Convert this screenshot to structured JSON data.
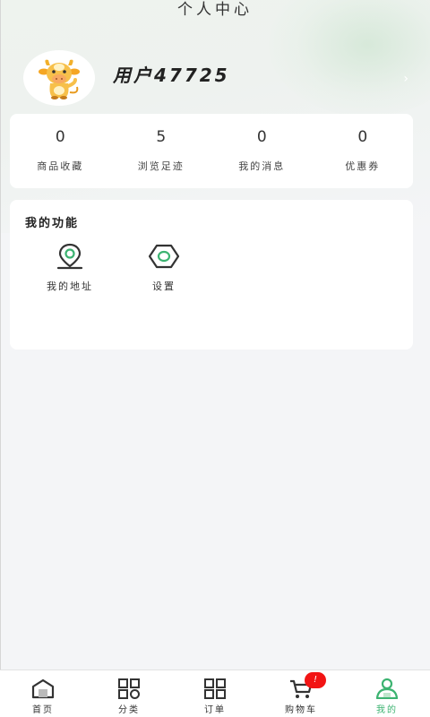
{
  "page": {
    "title": "个人中心"
  },
  "profile": {
    "username": "用户47725",
    "avatar_icon": "cow-mascot-avatar",
    "arrow": "›"
  },
  "stats": [
    {
      "value": "0",
      "label": "商品收藏"
    },
    {
      "value": "5",
      "label": "浏览足迹"
    },
    {
      "value": "0",
      "label": "我的消息"
    },
    {
      "value": "0",
      "label": "优惠券"
    }
  ],
  "functions": {
    "title": "我的功能",
    "items": [
      {
        "label": "我的地址",
        "icon": "location-pin-icon"
      },
      {
        "label": "设置",
        "icon": "settings-hexagon-icon"
      }
    ]
  },
  "tabbar": {
    "items": [
      {
        "label": "首页",
        "icon": "home-icon"
      },
      {
        "label": "分类",
        "icon": "category-grid-icon"
      },
      {
        "label": "订单",
        "icon": "order-grid-icon"
      },
      {
        "label": "购物车",
        "icon": "cart-icon",
        "badge": "!"
      },
      {
        "label": "我的",
        "icon": "user-icon",
        "active": true
      }
    ]
  },
  "colors": {
    "accent": "#3cb371",
    "badge": "#f21414",
    "background": "#f4f5f7"
  }
}
